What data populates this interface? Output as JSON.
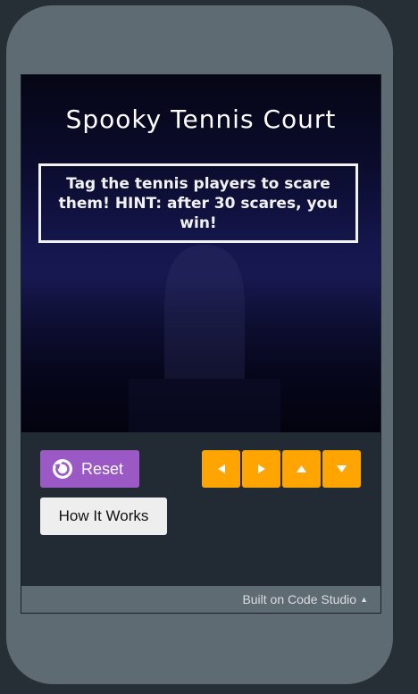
{
  "app": {
    "footer_label": "Built on Code Studio",
    "footer_icon": "caret-up-icon"
  },
  "game": {
    "title": "Spooky Tennis Court",
    "hint": "Tag the tennis players to scare them! HINT: after 30 scares, you win!"
  },
  "controls": {
    "reset_label": "Reset",
    "reset_icon": "reset-icon",
    "how_label": "How It Works",
    "arrows": [
      {
        "name": "left-arrow-icon"
      },
      {
        "name": "right-arrow-icon"
      },
      {
        "name": "up-arrow-icon"
      },
      {
        "name": "down-arrow-icon"
      }
    ]
  },
  "colors": {
    "reset_button": "#9b59c6",
    "arrow_buttons": "#ffa400",
    "frame": "#5f6b73"
  }
}
